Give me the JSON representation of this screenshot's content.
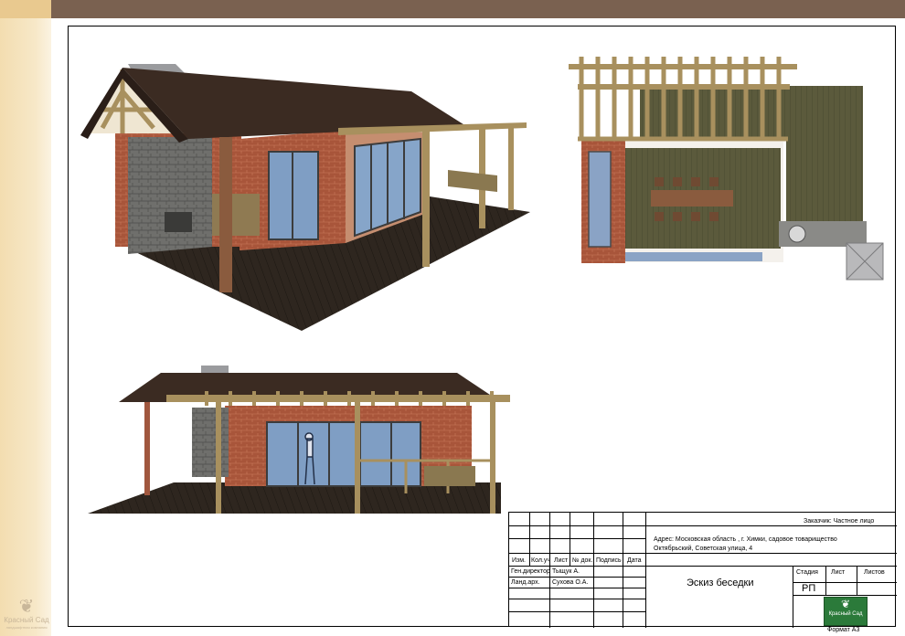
{
  "title_block": {
    "client": "Заказчик: Частное лицо",
    "address_line1": "Адрес: Московская область , г. Химки, садовое товарищество",
    "address_line2": "Октябрьский, Советская улица, 4",
    "col_headers": [
      "Изм.",
      "Кол.уч",
      "Лист",
      "№ док.",
      "Подпись",
      "Дата"
    ],
    "role1": "Ген.директор",
    "name1": "Тыщук А.",
    "role2": "Ланд.арх.",
    "name2": "Сухова О.А.",
    "drawing_title": "Эскиз беседки",
    "stage_label": "Стадия",
    "sheet_label": "Лист",
    "sheets_label": "Листов",
    "stage_value": "РП",
    "logo_text": "Красный Сад",
    "format": "Формат А3"
  },
  "corner_logo": {
    "name": "Красный Сад",
    "tagline": "ландшафтная компания"
  },
  "colors": {
    "roof": "#3b2b22",
    "brick": "#a8553a",
    "stone": "#6f6f6c",
    "deck": "#2e261f",
    "timber": "#a8905e",
    "glass": "#7f9ec4",
    "wood_floor": "#5b5a3c"
  }
}
